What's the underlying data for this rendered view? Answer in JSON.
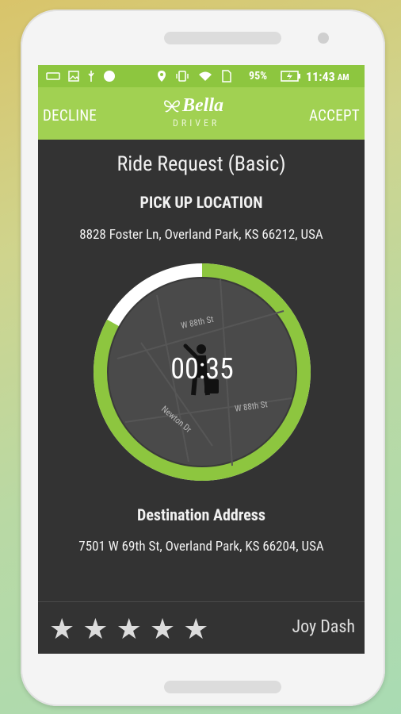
{
  "status": {
    "battery": "95%",
    "time": "11:43",
    "ampm": "AM"
  },
  "appbar": {
    "decline": "DECLINE",
    "accept": "ACCEPT",
    "logo_main": "Bella",
    "logo_sub": "DRIVER"
  },
  "request": {
    "title": "Ride Request (Basic)",
    "pickup_label": "PICK UP LOCATION",
    "pickup_address": "8828 Foster Ln, Overland Park, KS 66212, USA",
    "timer": "00:35",
    "timer_progress": 0.83,
    "dest_label": "Destination Address",
    "dest_address": "7501 W 69th St, Overland Park, KS 66204, USA"
  },
  "map": {
    "street1": "W 88th St",
    "street2": "W 88th St",
    "street3": "Newton Dr"
  },
  "rating": {
    "stars": 5
  },
  "driver": {
    "name": "Joy Dash"
  },
  "colors": {
    "accent": "#8dc63f",
    "appbar": "#a1d152",
    "screen": "#333333"
  }
}
